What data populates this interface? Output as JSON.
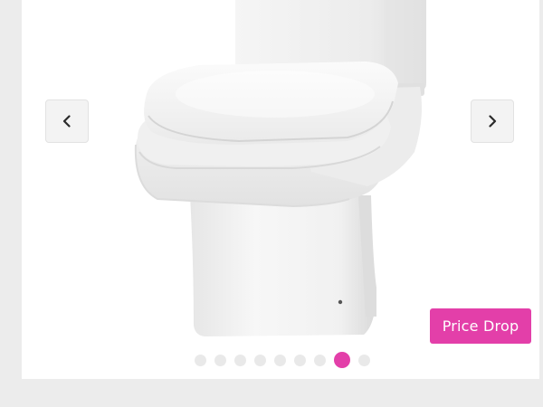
{
  "carousel": {
    "badge_label": "Price Drop",
    "slide_count": 9,
    "active_slide": 8,
    "accent_color": "#e33fa9",
    "image_subject": "close-coupled-toilet",
    "prev_icon": "chevron-left-icon",
    "next_icon": "chevron-right-icon"
  }
}
